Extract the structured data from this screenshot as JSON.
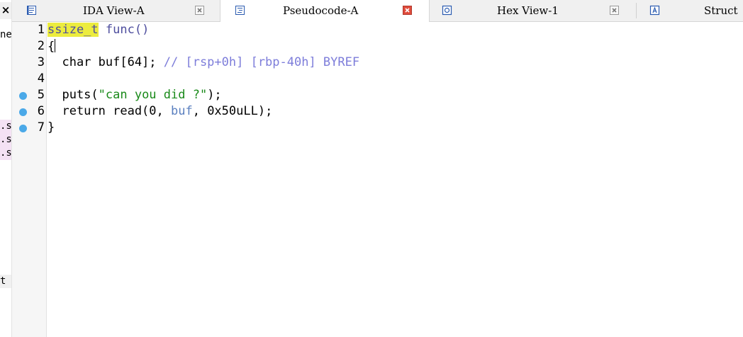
{
  "left_panel": {
    "close_glyph": "×",
    "fragments": [
      "ne",
      ".s",
      ".s",
      ".s",
      "t"
    ]
  },
  "tabs": [
    {
      "label": "IDA View-A",
      "icon": "disassembly-icon",
      "active": false
    },
    {
      "label": "Pseudocode-A",
      "icon": "pseudocode-icon",
      "active": true
    },
    {
      "label": "Hex View-1",
      "icon": "hex-view-icon",
      "active": false
    },
    {
      "label": "Struct",
      "icon": "structures-icon",
      "active": false
    }
  ],
  "colors": {
    "breakpoint": "#4ba9e8",
    "highlight": "#ecec3e",
    "close_active": "#e04b3c"
  },
  "code": {
    "line_numbers": [
      "1",
      "2",
      "3",
      "4",
      "5",
      "6",
      "7"
    ],
    "l1_type": "ssize_t",
    "l1_rest": " func()",
    "l2": "{",
    "l3_code": "  char buf[64]; ",
    "l3_comment": "// [rsp+0h] [rbp-40h] BYREF",
    "l5_a": "  puts(",
    "l5_str": "\"can you did ?\"",
    "l5_b": ");",
    "l6_a": "  return read(0, ",
    "l6_var": "buf",
    "l6_b": ", 0x50uLL);",
    "l7": "}"
  }
}
